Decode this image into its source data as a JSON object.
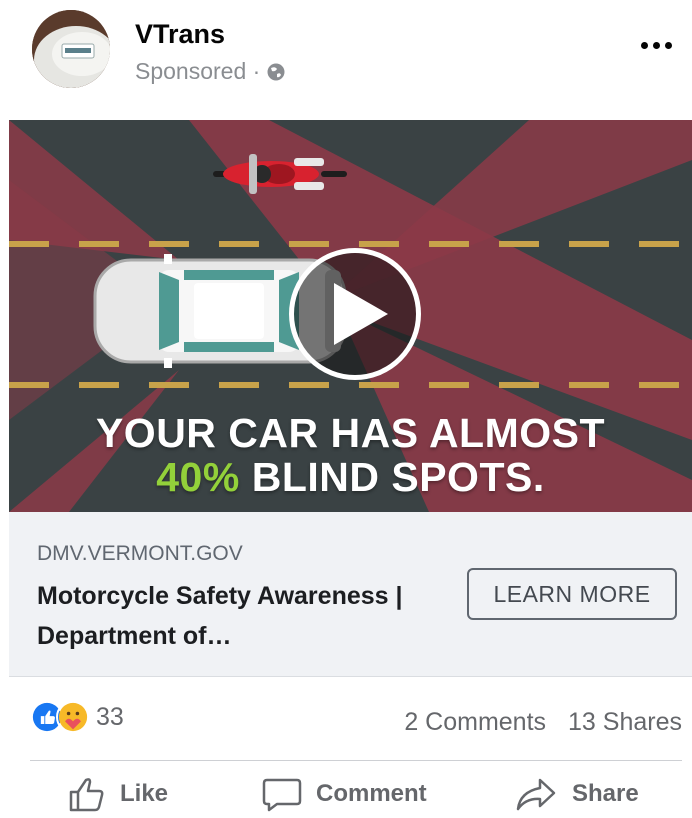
{
  "post": {
    "page_name": "VTrans",
    "sponsored": "Sponsored ·",
    "headline_line1": "YOUR CAR HAS ALMOST",
    "headline_percent": "40%",
    "headline_line2_rest": " BLIND SPOTS."
  },
  "link": {
    "domain": "DMV.VERMONT.GOV",
    "title": "Motorcycle Safety Awareness | Department of…",
    "cta": "LEARN MORE"
  },
  "engagement": {
    "reaction_count": "33",
    "comments": "2 Comments",
    "shares": "13 Shares"
  },
  "actions": {
    "like": "Like",
    "comment": "Comment",
    "share": "Share"
  },
  "icons": {
    "more": "more-options-icon",
    "globe": "globe-icon",
    "play": "play-icon",
    "like_reaction": "like-reaction-icon",
    "care_reaction": "care-reaction-icon"
  },
  "colors": {
    "accent_green": "#93d13a",
    "road": "#3a4244",
    "blind_spot_red": "#8c3a48",
    "like_blue": "#1877f2",
    "motorcycle_red": "#d8222f"
  }
}
